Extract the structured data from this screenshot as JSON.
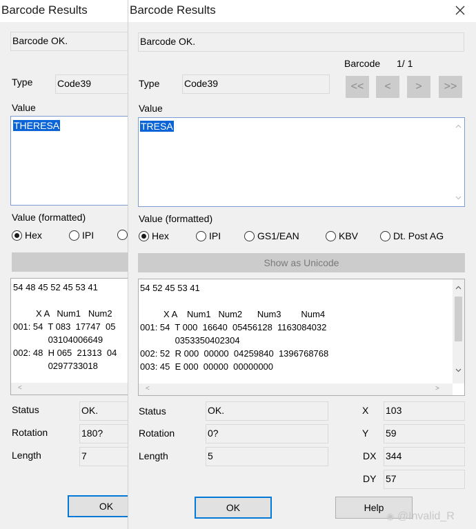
{
  "back_window": {
    "title": "Barcode Results",
    "status_message": "Barcode OK.",
    "type_label": "Type",
    "type_value": "Code39",
    "value_label": "Value",
    "value_text": "THERESA",
    "formatted_label": "Value (formatted)",
    "radio_hex": "Hex",
    "radio_ipi": "IPI",
    "hex_line": "54 48 45 52 45 53 41",
    "table_header": "X A   Num1   Num2",
    "rows": [
      "001: 54  T 083  17747  05",
      "              03104006649",
      "002: 48  H 065  21313  04",
      "              0297733018"
    ],
    "status_label": "Status",
    "status_value": "OK.",
    "rotation_label": "Rotation",
    "rotation_value": "180?",
    "length_label": "Length",
    "length_value": "7",
    "ok_label": "OK"
  },
  "front_window": {
    "title": "Barcode Results",
    "status_message": "Barcode OK.",
    "barcode_label": "Barcode",
    "barcode_index": "1/ 1",
    "nav": {
      "first": "<<",
      "prev": "<",
      "next": ">",
      "last": ">>"
    },
    "type_label": "Type",
    "type_value": "Code39",
    "value_label": "Value",
    "value_text": "TRESA",
    "formatted_label": "Value (formatted)",
    "radios": [
      {
        "label": "Hex",
        "selected": true
      },
      {
        "label": "IPI",
        "selected": false
      },
      {
        "label": "GS1/EAN",
        "selected": false
      },
      {
        "label": "KBV",
        "selected": false
      },
      {
        "label": "Dt. Post AG",
        "selected": false
      }
    ],
    "unicode_button": "Show as Unicode",
    "hex_line": "54 52 45 53 41",
    "table_header": "X A    Num1   Num2      Num3        Num4",
    "rows": [
      "001: 54  T 000  16640  05456128  1163084032",
      "              0353350402304",
      "002: 52  R 000  00000  04259840  1396768768",
      "003: 45  E 000  00000  00000000"
    ],
    "status_label": "Status",
    "status_value": "OK.",
    "rotation_label": "Rotation",
    "rotation_value": "0?",
    "length_label": "Length",
    "length_value": "5",
    "x_label": "X",
    "x_value": "103",
    "y_label": "Y",
    "y_value": "59",
    "dx_label": "DX",
    "dx_value": "344",
    "dy_label": "DY",
    "dy_value": "57",
    "ok_label": "OK",
    "help_label": "Help",
    "close_icon": "close-icon"
  },
  "watermark": "@Invalid_R"
}
